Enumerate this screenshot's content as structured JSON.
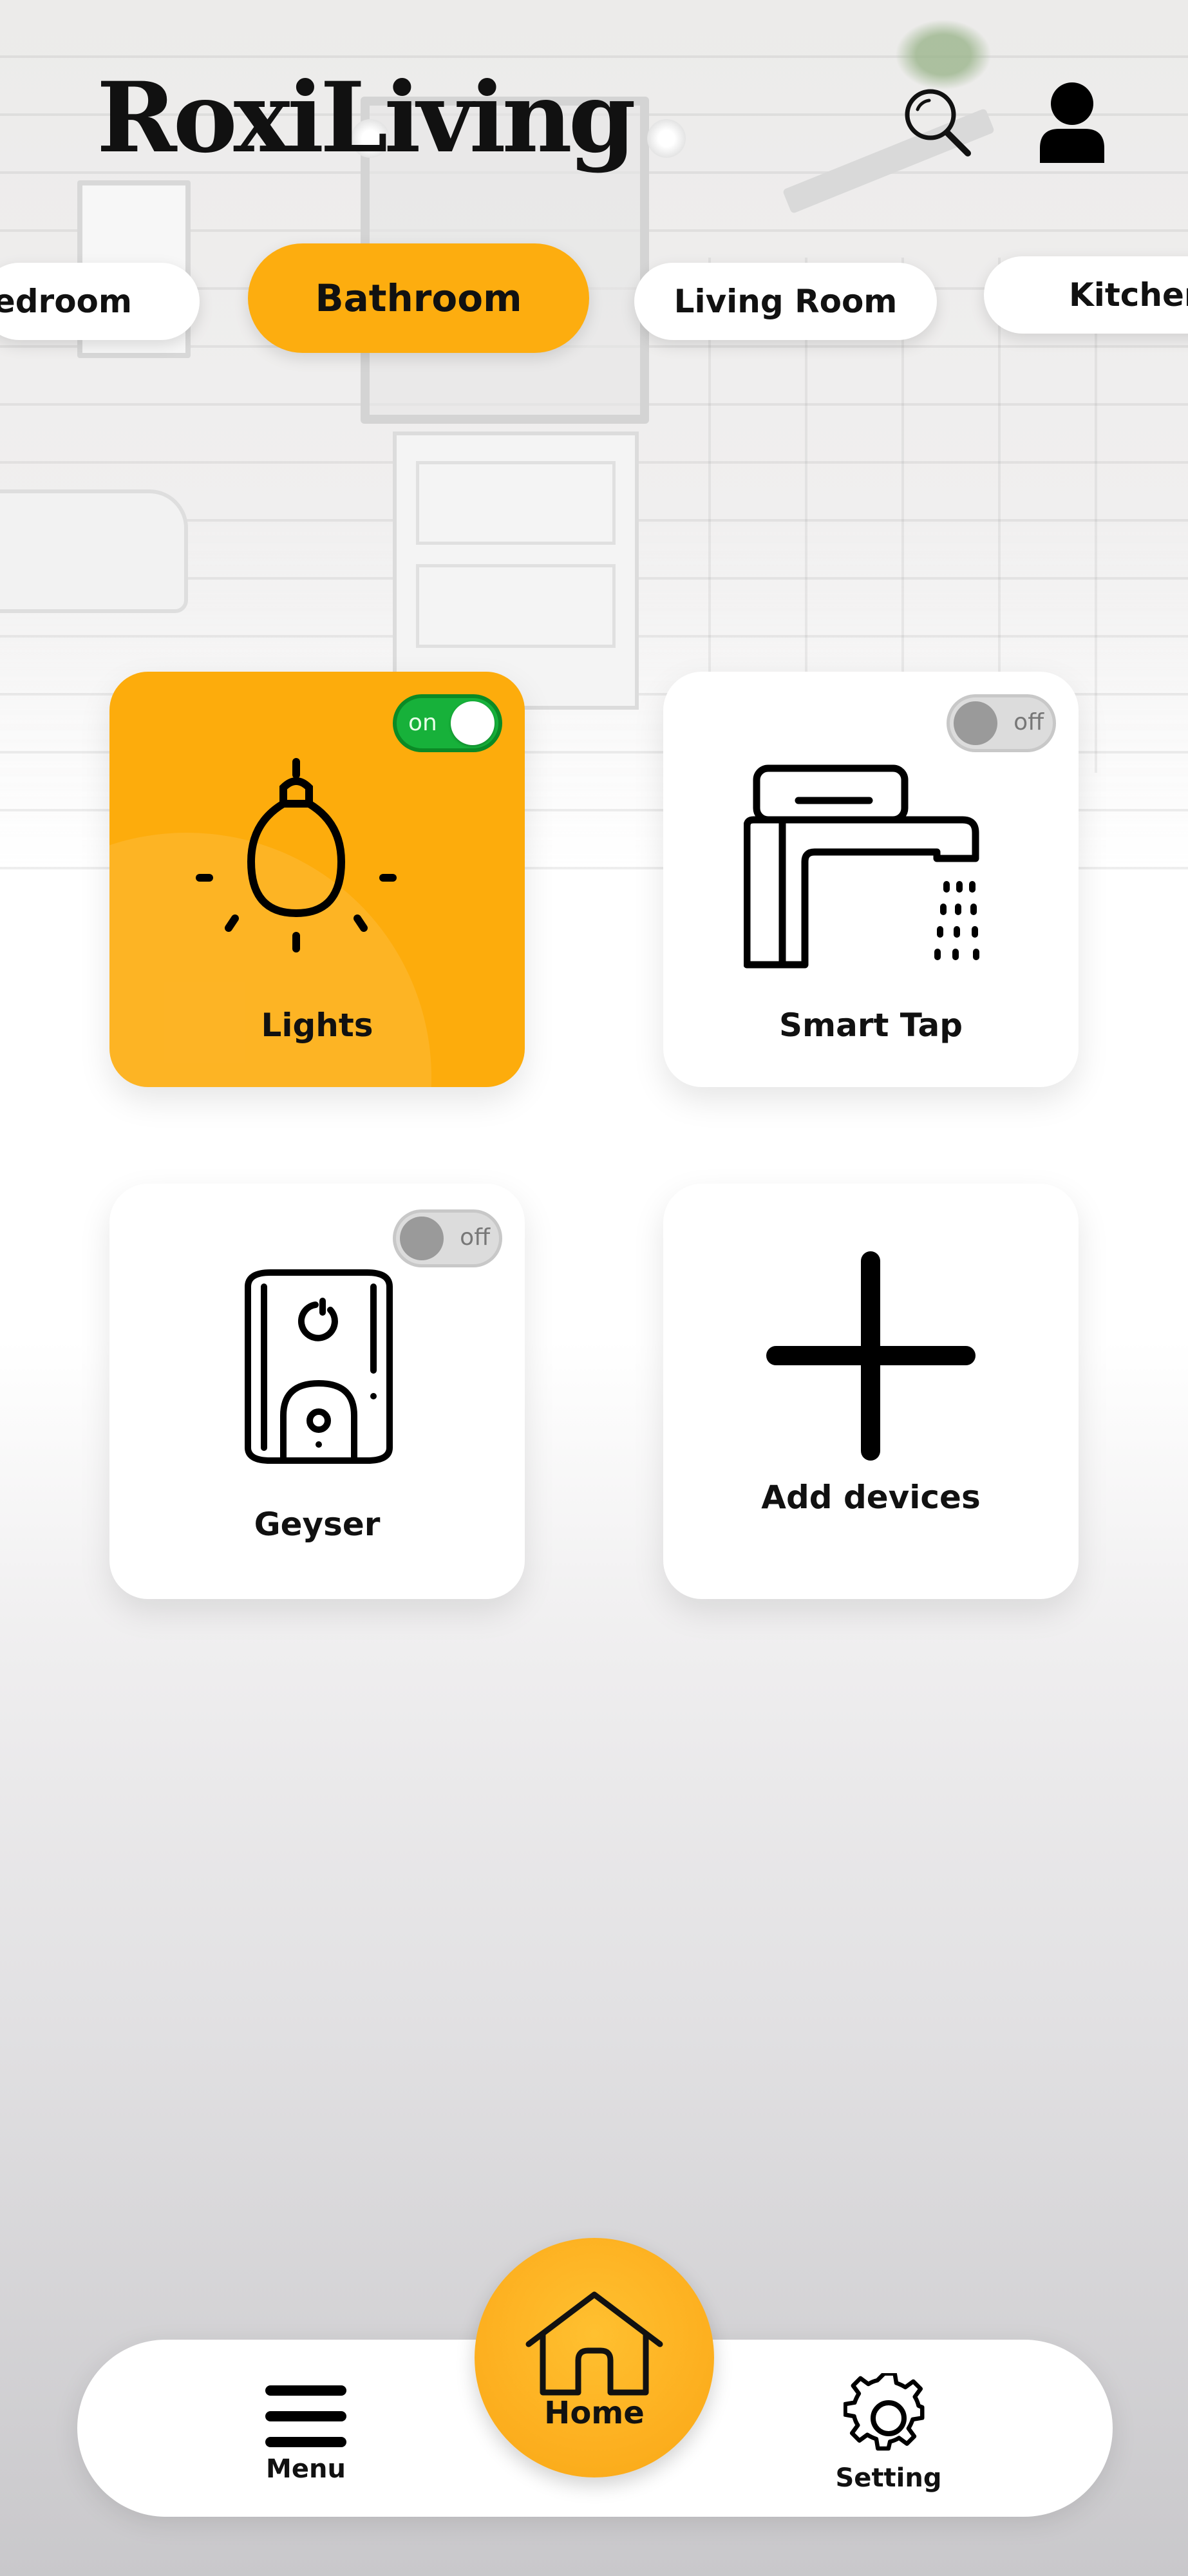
{
  "app": {
    "logo_text": "RoxiLiving"
  },
  "header": {
    "search_icon": "search-icon",
    "user_icon": "user-icon"
  },
  "rooms": {
    "tabs": [
      {
        "label": "Bedroom",
        "active": false
      },
      {
        "label": "Bathroom",
        "active": true
      },
      {
        "label": "Living Room",
        "active": false
      },
      {
        "label": "Kitchen",
        "active": false
      }
    ]
  },
  "devices": [
    {
      "name": "Lights",
      "icon": "lightbulb-icon",
      "state": "on",
      "toggle_label": "on"
    },
    {
      "name": "Smart Tap",
      "icon": "faucet-icon",
      "state": "off",
      "toggle_label": "off"
    },
    {
      "name": "Geyser",
      "icon": "water-heater-icon",
      "state": "off",
      "toggle_label": "off"
    },
    {
      "name": "Add devices",
      "icon": "plus-icon"
    }
  ],
  "nav": {
    "menu_label": "Menu",
    "home_label": "Home",
    "setting_label": "Setting"
  },
  "colors": {
    "accent": "#fdad0f",
    "toggle_on": "#17b13a",
    "toggle_off": "#dcdcdc",
    "card": "#ffffff"
  }
}
